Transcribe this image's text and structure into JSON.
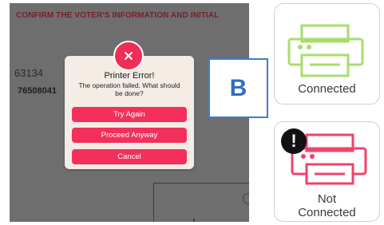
{
  "screen": {
    "header": "CONFIRM THE VOTER'S INFORMATION AND INITIAL",
    "number_partial_1": "63134",
    "number_partial_2": "76508041"
  },
  "dialog": {
    "icon": "close-icon",
    "title": "Printer Error!",
    "message": "The operation failed. What should be done?",
    "buttons": {
      "try_again": "Try Again",
      "proceed_anyway": "Proceed Anyway",
      "cancel": "Cancel"
    },
    "accent_color": "#f2305b"
  },
  "panel_label": "B",
  "status": {
    "connected": {
      "label": "Connected",
      "icon": "printer-icon",
      "color": "#a8dd6e"
    },
    "not_connected": {
      "label_line1": "Not",
      "label_line2": "Connected",
      "icon": "printer-icon",
      "badge_icon": "exclamation-icon",
      "color": "#f0426a"
    }
  }
}
